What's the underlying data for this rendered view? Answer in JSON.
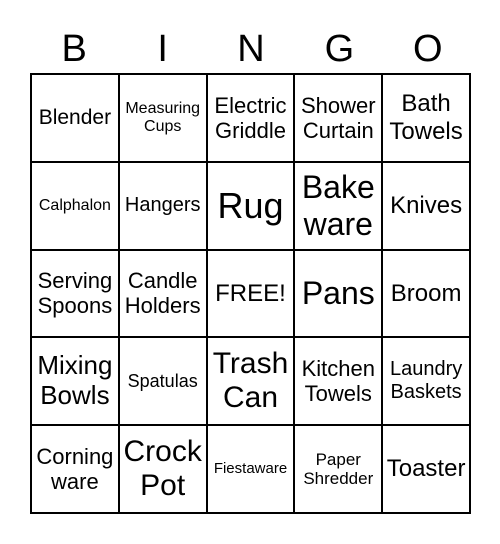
{
  "header": [
    "B",
    "I",
    "N",
    "G",
    "O"
  ],
  "cells": [
    "Blender",
    "Measuring Cups",
    "Electric Griddle",
    "Shower Curtain",
    "Bath Towels",
    "Calphalon",
    "Hangers",
    "Rug",
    "Bake ware",
    "Knives",
    "Serving Spoons",
    "Candle Holders",
    "FREE!",
    "Pans",
    "Broom",
    "Mixing Bowls",
    "Spatulas",
    "Trash Can",
    "Kitchen Towels",
    "Laundry Baskets",
    "Corning ware",
    "Crock Pot",
    "Fiestaware",
    "Paper Shredder",
    "Toaster"
  ]
}
